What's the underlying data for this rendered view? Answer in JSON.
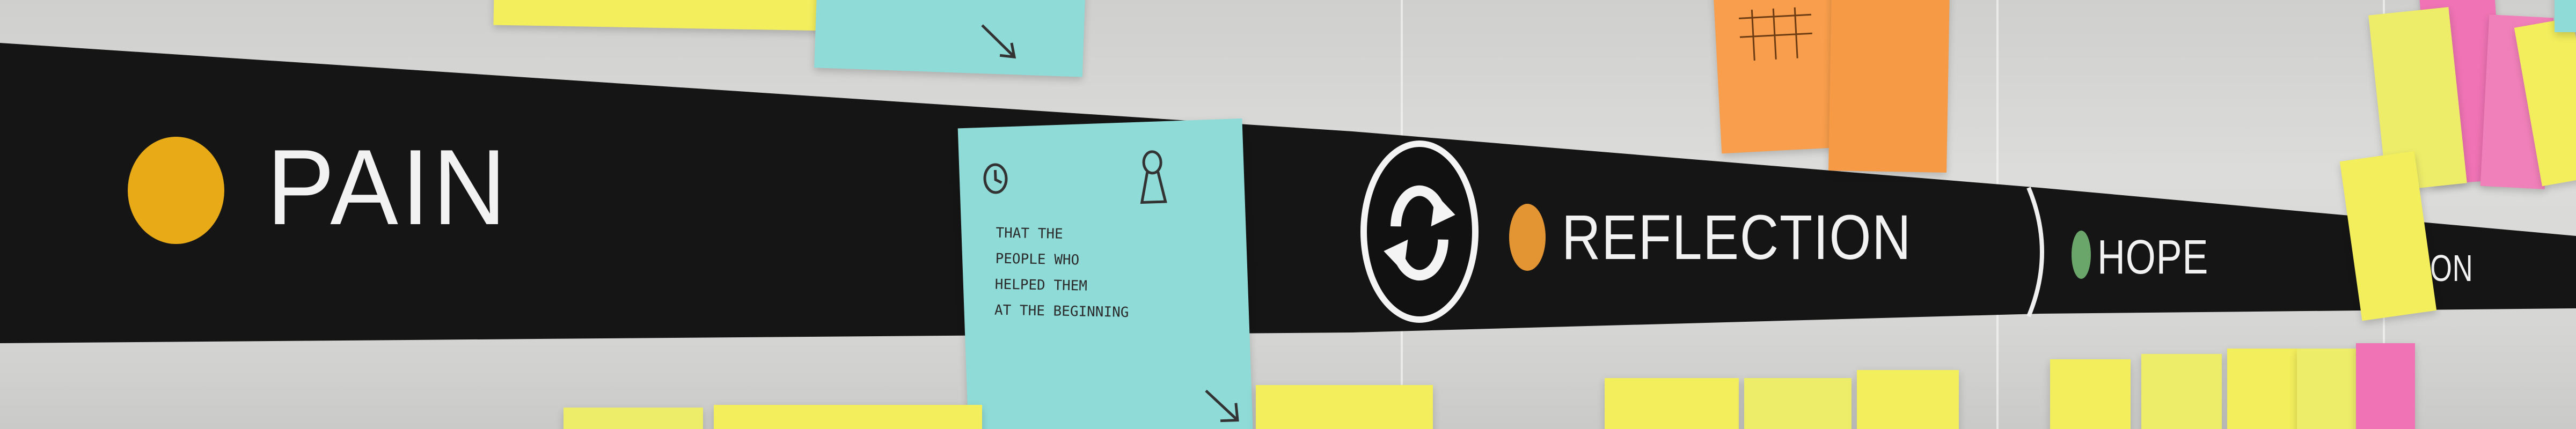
{
  "board": {
    "stages": [
      {
        "label": "PAIN",
        "dot_color": "#e8ab17"
      },
      {
        "label": "REFLECTION",
        "dot_color": "#e39433"
      },
      {
        "label": "HOPE",
        "dot_color": "#6aa56a"
      },
      {
        "label": "TION",
        "dot_color": ""
      }
    ],
    "band_color": "#151515",
    "cycle_icon": "refresh-cycle-icon"
  },
  "notes": {
    "main": {
      "color": "#8fdbd8",
      "icons": [
        "clock-icon",
        "keyhole-icon"
      ],
      "text": "THAT THE\nPEOPLE WHO\nHELPED THEM\nAT THE BEGINNING",
      "arrow_icon": "arrow-down-right-icon"
    },
    "colors": {
      "yellow": "#f3ee5c",
      "pale_yellow": "#eeed6a",
      "cyan": "#8fdbd8",
      "orange": "#f79a46",
      "pink": "#ef73b5"
    }
  }
}
